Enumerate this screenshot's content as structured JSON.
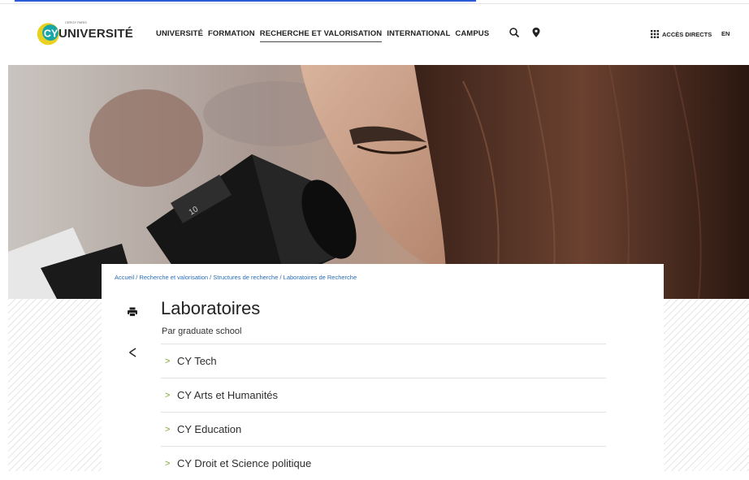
{
  "header": {
    "logo_brand": "UNIVERSITÉ",
    "logo_small": "CERGY PARIS",
    "nav": [
      "UNIVERSITÉ",
      "FORMATION",
      "RECHERCHE ET VALORISATION",
      "INTERNATIONAL",
      "CAMPUS"
    ],
    "active_nav": "RECHERCHE ET VALORISATION",
    "acces_directs": "ACCÈS DIRECTS",
    "lang": "EN"
  },
  "breadcrumb": {
    "items": [
      "Accueil",
      "Recherche et valorisation",
      "Structures de recherche",
      "Laboratoires de Recherche"
    ],
    "separator": " / "
  },
  "page": {
    "title": "Laboratoires",
    "subtitle": "Par graduate school",
    "items": [
      "CY Tech",
      "CY Arts et Humanités",
      "CY Education",
      "CY Droit et Science politique"
    ]
  },
  "icons": {
    "search": "search-icon",
    "location": "location-pin-icon",
    "grid": "grid-icon",
    "print": "print-icon",
    "share": "share-icon",
    "chevron": "chevron-right-icon"
  },
  "colors": {
    "accent_green": "#7aa52e",
    "link_blue": "#2a6db5",
    "logo_yellow": "#e8d21f",
    "logo_teal": "#1aa6a6"
  }
}
